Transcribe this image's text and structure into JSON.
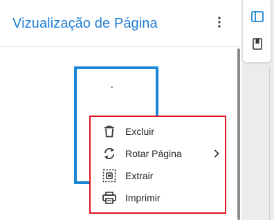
{
  "panel": {
    "title": "Vizualização de Página",
    "more_icon": "more-vertical-icon"
  },
  "rail": {
    "buttons": [
      {
        "icon": "sidebar-panel-icon",
        "selected": true
      },
      {
        "icon": "bookmark-icon",
        "selected": false
      }
    ]
  },
  "context_menu": {
    "items": [
      {
        "label": "Excluir",
        "icon": "trash-icon"
      },
      {
        "label": "Rotar Página",
        "icon": "rotate-icon",
        "has_submenu": true
      },
      {
        "label": "Extrair",
        "icon": "extract-icon"
      },
      {
        "label": "Imprimir",
        "icon": "printer-icon"
      }
    ]
  },
  "colors": {
    "accent": "#1a86d8",
    "title": "#1f7ed6",
    "highlight_border": "#e0161e"
  }
}
